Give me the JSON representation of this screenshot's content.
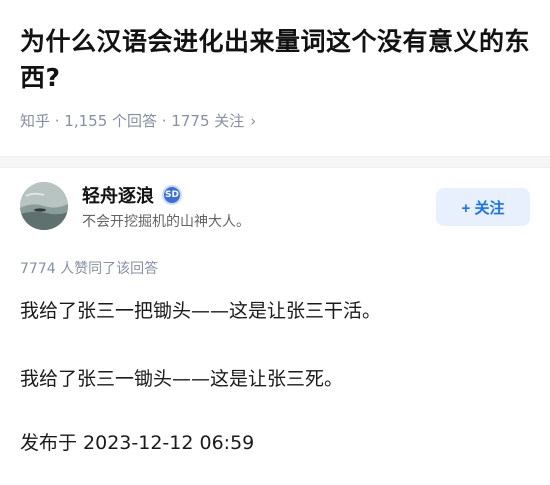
{
  "question": {
    "title": "为什么汉语会进化出来量词这个没有意义的东西?",
    "meta": "知乎 · 1,155 个回答 · 1775 关注",
    "chevron": "›"
  },
  "author": {
    "name": "轻舟逐浪",
    "badge": "SD",
    "bio": "不会开挖掘机的山神大人。",
    "follow_label": "+ 关注",
    "avatar_icon": "landscape-avatar"
  },
  "answer": {
    "vote_text": "7774 人赞同了该回答",
    "paragraphs": [
      "我给了张三一把锄头——这是让张三干活。",
      "我给了张三一锄头——这是让张三死。"
    ],
    "publish_time": "发布于 2023-12-12 06:59"
  },
  "colors": {
    "accent": "#1772f6",
    "follow_bg": "#e8f0fe",
    "meta_gray": "#8590a6"
  }
}
